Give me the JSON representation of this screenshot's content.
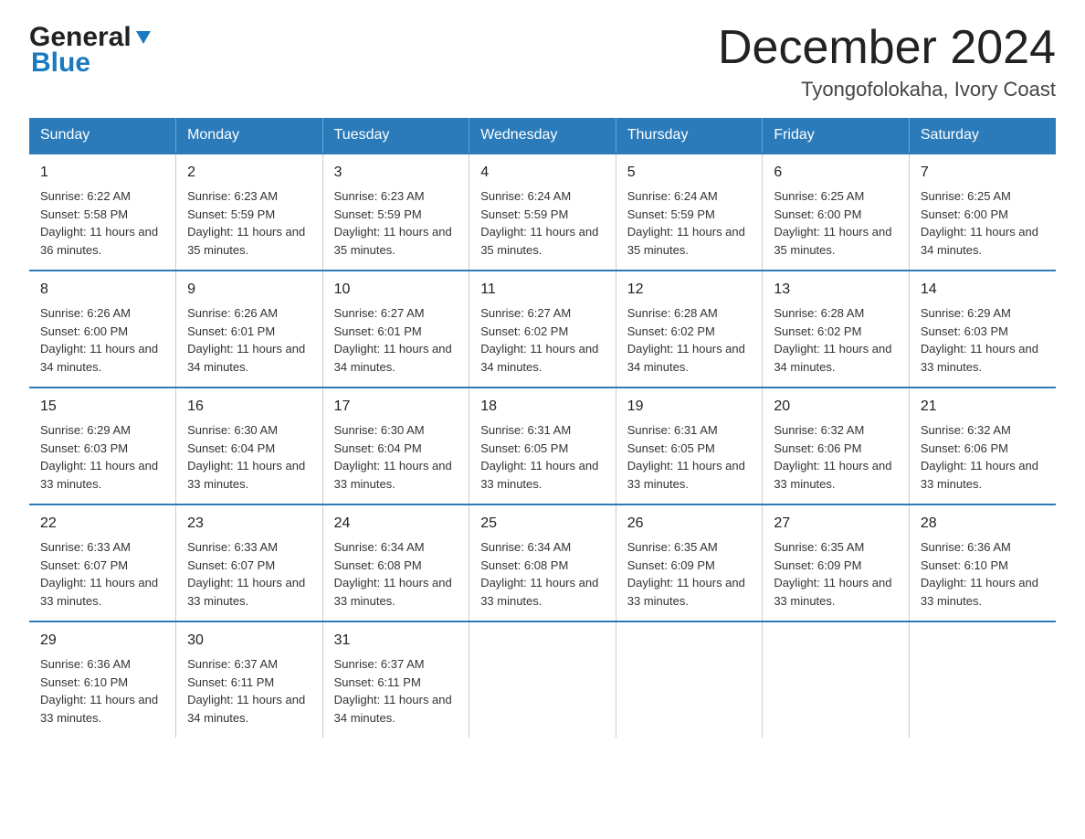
{
  "header": {
    "logo_general": "General",
    "logo_blue": "Blue",
    "month_title": "December 2024",
    "location": "Tyongofolokaha, Ivory Coast"
  },
  "days_of_week": [
    "Sunday",
    "Monday",
    "Tuesday",
    "Wednesday",
    "Thursday",
    "Friday",
    "Saturday"
  ],
  "weeks": [
    [
      {
        "day": "1",
        "sunrise": "6:22 AM",
        "sunset": "5:58 PM",
        "daylight": "11 hours and 36 minutes."
      },
      {
        "day": "2",
        "sunrise": "6:23 AM",
        "sunset": "5:59 PM",
        "daylight": "11 hours and 35 minutes."
      },
      {
        "day": "3",
        "sunrise": "6:23 AM",
        "sunset": "5:59 PM",
        "daylight": "11 hours and 35 minutes."
      },
      {
        "day": "4",
        "sunrise": "6:24 AM",
        "sunset": "5:59 PM",
        "daylight": "11 hours and 35 minutes."
      },
      {
        "day": "5",
        "sunrise": "6:24 AM",
        "sunset": "5:59 PM",
        "daylight": "11 hours and 35 minutes."
      },
      {
        "day": "6",
        "sunrise": "6:25 AM",
        "sunset": "6:00 PM",
        "daylight": "11 hours and 35 minutes."
      },
      {
        "day": "7",
        "sunrise": "6:25 AM",
        "sunset": "6:00 PM",
        "daylight": "11 hours and 34 minutes."
      }
    ],
    [
      {
        "day": "8",
        "sunrise": "6:26 AM",
        "sunset": "6:00 PM",
        "daylight": "11 hours and 34 minutes."
      },
      {
        "day": "9",
        "sunrise": "6:26 AM",
        "sunset": "6:01 PM",
        "daylight": "11 hours and 34 minutes."
      },
      {
        "day": "10",
        "sunrise": "6:27 AM",
        "sunset": "6:01 PM",
        "daylight": "11 hours and 34 minutes."
      },
      {
        "day": "11",
        "sunrise": "6:27 AM",
        "sunset": "6:02 PM",
        "daylight": "11 hours and 34 minutes."
      },
      {
        "day": "12",
        "sunrise": "6:28 AM",
        "sunset": "6:02 PM",
        "daylight": "11 hours and 34 minutes."
      },
      {
        "day": "13",
        "sunrise": "6:28 AM",
        "sunset": "6:02 PM",
        "daylight": "11 hours and 34 minutes."
      },
      {
        "day": "14",
        "sunrise": "6:29 AM",
        "sunset": "6:03 PM",
        "daylight": "11 hours and 33 minutes."
      }
    ],
    [
      {
        "day": "15",
        "sunrise": "6:29 AM",
        "sunset": "6:03 PM",
        "daylight": "11 hours and 33 minutes."
      },
      {
        "day": "16",
        "sunrise": "6:30 AM",
        "sunset": "6:04 PM",
        "daylight": "11 hours and 33 minutes."
      },
      {
        "day": "17",
        "sunrise": "6:30 AM",
        "sunset": "6:04 PM",
        "daylight": "11 hours and 33 minutes."
      },
      {
        "day": "18",
        "sunrise": "6:31 AM",
        "sunset": "6:05 PM",
        "daylight": "11 hours and 33 minutes."
      },
      {
        "day": "19",
        "sunrise": "6:31 AM",
        "sunset": "6:05 PM",
        "daylight": "11 hours and 33 minutes."
      },
      {
        "day": "20",
        "sunrise": "6:32 AM",
        "sunset": "6:06 PM",
        "daylight": "11 hours and 33 minutes."
      },
      {
        "day": "21",
        "sunrise": "6:32 AM",
        "sunset": "6:06 PM",
        "daylight": "11 hours and 33 minutes."
      }
    ],
    [
      {
        "day": "22",
        "sunrise": "6:33 AM",
        "sunset": "6:07 PM",
        "daylight": "11 hours and 33 minutes."
      },
      {
        "day": "23",
        "sunrise": "6:33 AM",
        "sunset": "6:07 PM",
        "daylight": "11 hours and 33 minutes."
      },
      {
        "day": "24",
        "sunrise": "6:34 AM",
        "sunset": "6:08 PM",
        "daylight": "11 hours and 33 minutes."
      },
      {
        "day": "25",
        "sunrise": "6:34 AM",
        "sunset": "6:08 PM",
        "daylight": "11 hours and 33 minutes."
      },
      {
        "day": "26",
        "sunrise": "6:35 AM",
        "sunset": "6:09 PM",
        "daylight": "11 hours and 33 minutes."
      },
      {
        "day": "27",
        "sunrise": "6:35 AM",
        "sunset": "6:09 PM",
        "daylight": "11 hours and 33 minutes."
      },
      {
        "day": "28",
        "sunrise": "6:36 AM",
        "sunset": "6:10 PM",
        "daylight": "11 hours and 33 minutes."
      }
    ],
    [
      {
        "day": "29",
        "sunrise": "6:36 AM",
        "sunset": "6:10 PM",
        "daylight": "11 hours and 33 minutes."
      },
      {
        "day": "30",
        "sunrise": "6:37 AM",
        "sunset": "6:11 PM",
        "daylight": "11 hours and 34 minutes."
      },
      {
        "day": "31",
        "sunrise": "6:37 AM",
        "sunset": "6:11 PM",
        "daylight": "11 hours and 34 minutes."
      },
      null,
      null,
      null,
      null
    ]
  ]
}
